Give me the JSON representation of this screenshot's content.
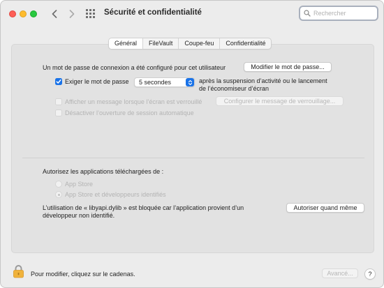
{
  "window": {
    "title": "Sécurité et confidentialité"
  },
  "search": {
    "placeholder": "Rechercher"
  },
  "tabs": [
    {
      "label": "Général",
      "active": true
    },
    {
      "label": "FileVault"
    },
    {
      "label": "Coupe-feu"
    },
    {
      "label": "Confidentialité"
    }
  ],
  "general": {
    "password_text": "Un mot de passe de connexion a été configuré pour cet utilisateur",
    "change_password_button": "Modifier le mot de passe...",
    "require_password_label": "Exiger le mot de passe",
    "require_password_checked": true,
    "delay_value": "5 secondes",
    "after_text_line1": "après la suspension d’activité ou le lancement",
    "after_text_line2": "de l’économiseur d’écran",
    "show_message_label": "Afficher un message lorsque l’écran est verrouillé",
    "configure_message_button": "Configurer le message de verrouillage...",
    "disable_autologin_label": "Désactiver l’ouverture de session automatique"
  },
  "downloads": {
    "heading": "Autorisez les applications téléchargées de :",
    "option_app_store": "App Store",
    "option_app_store_dev": "App Store et développeurs identifiés",
    "selected": "App Store et développeurs identifiés",
    "blocked_line1": "L’utilisation de « libyapi.dylib » est bloquée car l’application provient d’un",
    "blocked_line2": "développeur non identifié.",
    "allow_button": "Autoriser quand même"
  },
  "footer": {
    "lock_text": "Pour modifier, cliquez sur le cadenas.",
    "advanced_button": "Avancé...",
    "help_button": "?"
  },
  "colors": {
    "accent": "#1a73e8",
    "close": "#fe5f57",
    "minimize": "#febc2e",
    "zoom": "#28c840"
  },
  "icons": {
    "nav_back": "chevron-left-icon",
    "nav_forward": "chevron-right-icon",
    "show_all": "grid-icon",
    "search": "magnifier-icon",
    "lock": "padlock-icon"
  }
}
